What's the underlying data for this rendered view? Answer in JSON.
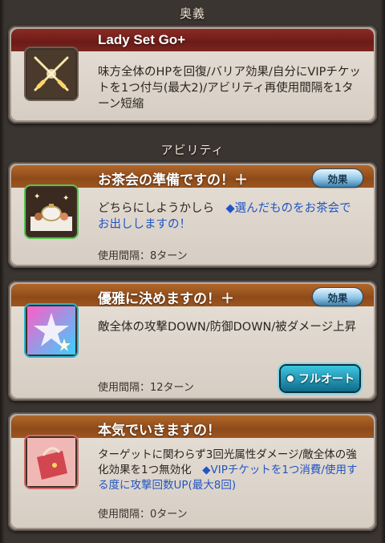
{
  "sections": {
    "ougi_label": "奥義",
    "ability_label": "アビリティ"
  },
  "ougi": {
    "name": "Lady Set Go+",
    "icon": "crossed-swords-icon",
    "description": "味方全体のHPを回復/バリア効果/自分にVIPチケットを1つ付与(最大2)/アビリティ再使用間隔を1ターン短縮"
  },
  "abilities": [
    {
      "name": "お茶会の準備ですの！＋",
      "icon": "tea-party-icon",
      "effect_label": "効果",
      "description_plain": "どちらにしようかしら　",
      "description_blue": "◆選んだものをお茶会でお出ししますの！",
      "cooldown": "使用間隔：8ターン"
    },
    {
      "name": "優雅に決めますの！＋",
      "icon": "sparkle-stars-icon",
      "effect_label": "効果",
      "description_plain": "敵全体の攻撃DOWN/防御DOWN/被ダメージ上昇",
      "cooldown": "使用間隔：12ターン",
      "full_auto_label": "フルオート"
    },
    {
      "name": "本気でいきますの！",
      "icon": "handbag-icon",
      "description_plain": "ターゲットに関わらず3回光属性ダメージ/敵全体の強化効果を1つ無効化　",
      "description_blue": "◆VIPチケットを1つ消費/使用する度に攻撃回数UP(最大8回)",
      "cooldown": "使用間隔：0ターン"
    }
  ],
  "colors": {
    "ougi_bar": "#7a2620",
    "ability_bar": "#9c5620",
    "blue_text": "#2155c3"
  }
}
